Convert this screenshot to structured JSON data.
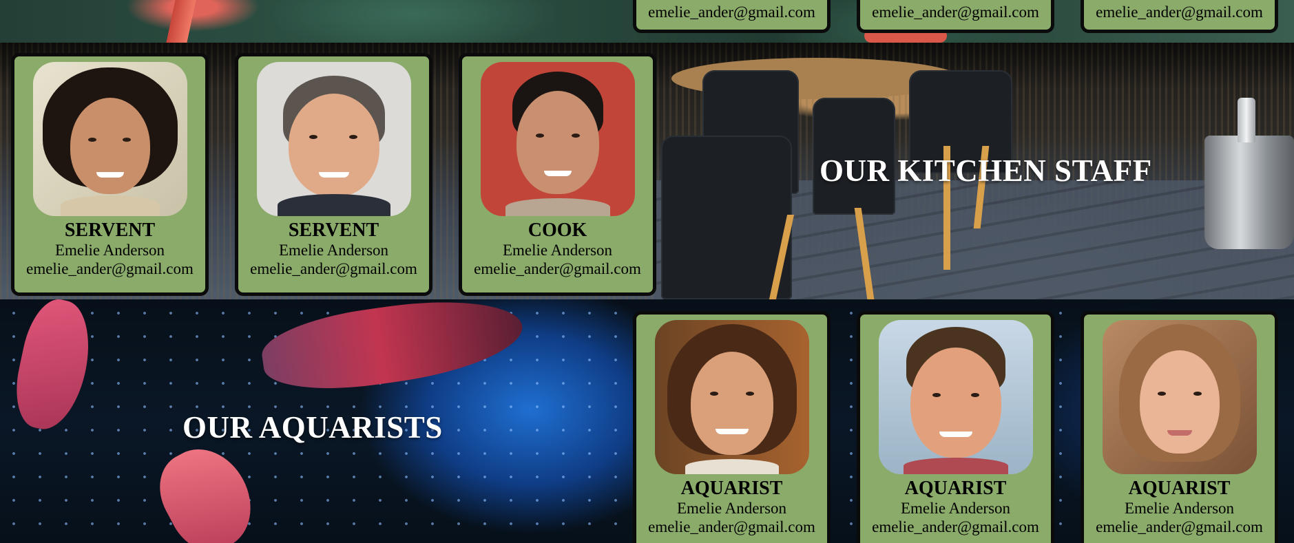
{
  "top_cards": [
    {
      "email": "emelie_ander@gmail.com"
    },
    {
      "email": "emelie_ander@gmail.com"
    },
    {
      "email": "emelie_ander@gmail.com"
    }
  ],
  "kitchen": {
    "title": "OUR KITCHEN STAFF",
    "cards": [
      {
        "role": "SERVENT",
        "name": "Emelie Anderson",
        "email": "emelie_ander@gmail.com"
      },
      {
        "role": "SERVENT",
        "name": "Emelie Anderson",
        "email": "emelie_ander@gmail.com"
      },
      {
        "role": "COOK",
        "name": "Emelie Anderson",
        "email": "emelie_ander@gmail.com"
      }
    ]
  },
  "aquarists": {
    "title": "OUR AQUARISTS",
    "cards": [
      {
        "role": "AQUARIST",
        "name": "Emelie Anderson",
        "email": "emelie_ander@gmail.com"
      },
      {
        "role": "AQUARIST",
        "name": "Emelie Anderson",
        "email": "emelie_ander@gmail.com"
      },
      {
        "role": "AQUARIST",
        "name": "Emelie Anderson",
        "email": "emelie_ander@gmail.com"
      }
    ]
  },
  "colors": {
    "card_background": "#8bab6a",
    "card_border": "#0b0b0b",
    "title_text": "#ffffff"
  }
}
